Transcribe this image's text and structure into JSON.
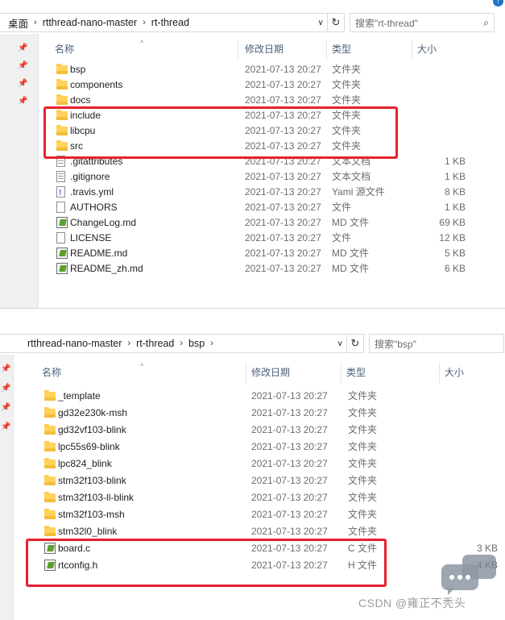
{
  "window1": {
    "breadcrumb": [
      "桌面",
      "rtthread-nano-master",
      "rt-thread"
    ],
    "search_placeholder": "搜索\"rt-thread\"",
    "columns": {
      "name": "名称",
      "date": "修改日期",
      "type": "类型",
      "size": "大小"
    },
    "files": [
      {
        "name": "bsp",
        "date": "2021-07-13 20:27",
        "type": "文件夹",
        "size": "",
        "icon": "folder"
      },
      {
        "name": "components",
        "date": "2021-07-13 20:27",
        "type": "文件夹",
        "size": "",
        "icon": "folder"
      },
      {
        "name": "docs",
        "date": "2021-07-13 20:27",
        "type": "文件夹",
        "size": "",
        "icon": "folder"
      },
      {
        "name": "include",
        "date": "2021-07-13 20:27",
        "type": "文件夹",
        "size": "",
        "icon": "folder"
      },
      {
        "name": "libcpu",
        "date": "2021-07-13 20:27",
        "type": "文件夹",
        "size": "",
        "icon": "folder"
      },
      {
        "name": "src",
        "date": "2021-07-13 20:27",
        "type": "文件夹",
        "size": "",
        "icon": "folder"
      },
      {
        "name": ".gitattributes",
        "date": "2021-07-13 20:27",
        "type": "文本文档",
        "size": "1 KB",
        "icon": "text-file"
      },
      {
        "name": ".gitignore",
        "date": "2021-07-13 20:27",
        "type": "文本文档",
        "size": "1 KB",
        "icon": "text-file"
      },
      {
        "name": ".travis.yml",
        "date": "2021-07-13 20:27",
        "type": "Yaml 源文件",
        "size": "8 KB",
        "icon": "yaml-file"
      },
      {
        "name": "AUTHORS",
        "date": "2021-07-13 20:27",
        "type": "文件",
        "size": "1 KB",
        "icon": "file"
      },
      {
        "name": "ChangeLog.md",
        "date": "2021-07-13 20:27",
        "type": "MD 文件",
        "size": "69 KB",
        "icon": "md-file"
      },
      {
        "name": "LICENSE",
        "date": "2021-07-13 20:27",
        "type": "文件",
        "size": "12 KB",
        "icon": "file"
      },
      {
        "name": "README.md",
        "date": "2021-07-13 20:27",
        "type": "MD 文件",
        "size": "5 KB",
        "icon": "md-file"
      },
      {
        "name": "README_zh.md",
        "date": "2021-07-13 20:27",
        "type": "MD 文件",
        "size": "6 KB",
        "icon": "md-file"
      }
    ]
  },
  "window2": {
    "breadcrumb": [
      "rtthread-nano-master",
      "rt-thread",
      "bsp"
    ],
    "search_placeholder": "搜索\"bsp\"",
    "columns": {
      "name": "名称",
      "date": "修改日期",
      "type": "类型",
      "size": "大小"
    },
    "files": [
      {
        "name": "_template",
        "date": "2021-07-13 20:27",
        "type": "文件夹",
        "size": "",
        "icon": "folder"
      },
      {
        "name": "gd32e230k-msh",
        "date": "2021-07-13 20:27",
        "type": "文件夹",
        "size": "",
        "icon": "folder"
      },
      {
        "name": "gd32vf103-blink",
        "date": "2021-07-13 20:27",
        "type": "文件夹",
        "size": "",
        "icon": "folder"
      },
      {
        "name": "lpc55s69-blink",
        "date": "2021-07-13 20:27",
        "type": "文件夹",
        "size": "",
        "icon": "folder"
      },
      {
        "name": "lpc824_blink",
        "date": "2021-07-13 20:27",
        "type": "文件夹",
        "size": "",
        "icon": "folder"
      },
      {
        "name": "stm32f103-blink",
        "date": "2021-07-13 20:27",
        "type": "文件夹",
        "size": "",
        "icon": "folder"
      },
      {
        "name": "stm32f103-ll-blink",
        "date": "2021-07-13 20:27",
        "type": "文件夹",
        "size": "",
        "icon": "folder"
      },
      {
        "name": "stm32f103-msh",
        "date": "2021-07-13 20:27",
        "type": "文件夹",
        "size": "",
        "icon": "folder"
      },
      {
        "name": "stm32l0_blink",
        "date": "2021-07-13 20:27",
        "type": "文件夹",
        "size": "",
        "icon": "folder"
      },
      {
        "name": "board.c",
        "date": "2021-07-13 20:27",
        "type": "C 文件",
        "size": "3 KB",
        "icon": "md-file"
      },
      {
        "name": "rtconfig.h",
        "date": "2021-07-13 20:27",
        "type": "H 文件",
        "size": "4 KB",
        "icon": "md-file"
      }
    ]
  },
  "watermark": "CSDN @雍正不秃头",
  "colors": {
    "highlight_box": "#e8202e",
    "column_header_text": "#4c607a",
    "folder": "#ffd35c"
  }
}
